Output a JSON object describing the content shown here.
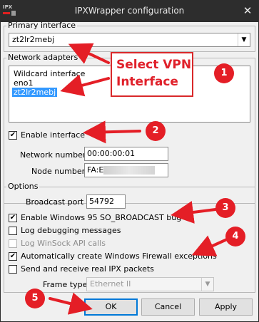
{
  "window": {
    "title": "IPXWrapper configuration",
    "close_glyph": "✕",
    "app_icon": "ipx-app-icon"
  },
  "primary_interface": {
    "legend": "Primary interface",
    "selected": "zt2lr2mebj"
  },
  "network_adapters": {
    "legend": "Network adapters",
    "items": [
      {
        "label": "Wildcard interface",
        "selected": false
      },
      {
        "label": "eno1",
        "selected": false
      },
      {
        "label": "zt2lr2mebj",
        "selected": true
      }
    ],
    "enable_interface_label": "Enable interface",
    "enable_interface_checked": true,
    "network_number_label": "Network number",
    "network_number_value": "00:00:00:01",
    "node_number_label": "Node number",
    "node_number_value": "FA:E"
  },
  "options": {
    "legend": "Options",
    "broadcast_port_label": "Broadcast port",
    "broadcast_port_value": "54792",
    "checkboxes": [
      {
        "label": "Enable Windows 95 SO_BROADCAST bug",
        "checked": true,
        "disabled": false
      },
      {
        "label": "Log debugging messages",
        "checked": false,
        "disabled": false
      },
      {
        "label": "Log WinSock API calls",
        "checked": false,
        "disabled": true
      },
      {
        "label": "Automatically create Windows Firewall exceptions",
        "checked": true,
        "disabled": false
      },
      {
        "label": "Send and receive real IPX packets",
        "checked": false,
        "disabled": false
      }
    ],
    "frame_type_label": "Frame type",
    "frame_type_value": "Ethernet II"
  },
  "buttons": {
    "ok": "OK",
    "cancel": "Cancel",
    "apply": "Apply"
  },
  "annotations": {
    "callout_line1": "Select VPN",
    "callout_line2": "Interface",
    "badges": [
      "1",
      "2",
      "3",
      "4",
      "5"
    ],
    "accent_color": "#e41e26"
  },
  "checkmark": "✔",
  "dropdown_arrow": "▼"
}
